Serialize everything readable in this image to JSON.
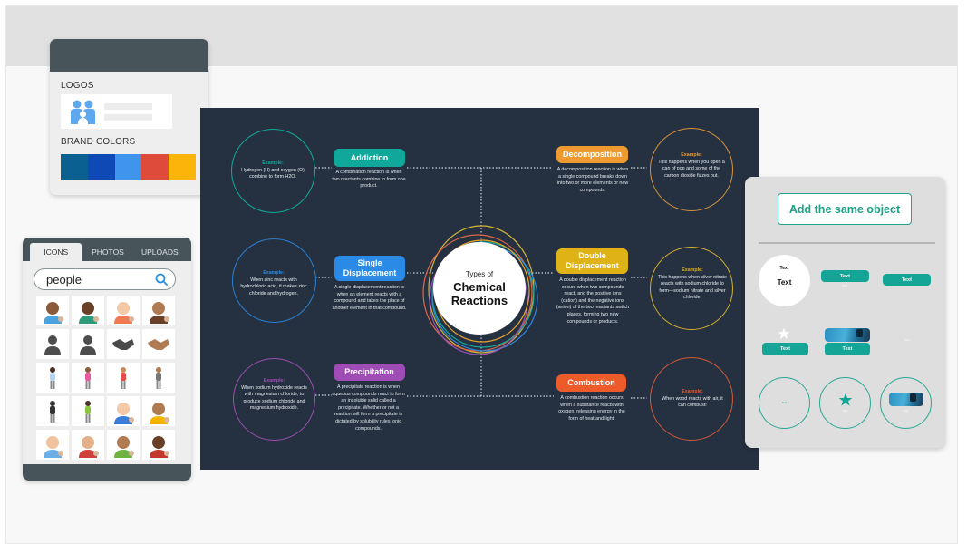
{
  "brand_panel": {
    "logos_label": "LOGOS",
    "logo_icon": "people-logo-icon",
    "brand_colors_label": "BRAND COLORS",
    "colors": [
      "#0a6191",
      "#0e49b5",
      "#3f95ec",
      "#df4b3a",
      "#fbb40a"
    ]
  },
  "icons_panel": {
    "tabs": [
      {
        "label": "ICONS",
        "active": true
      },
      {
        "label": "PHOTOS",
        "active": false
      },
      {
        "label": "UPLOADS",
        "active": false
      }
    ],
    "search_value": "people",
    "search_icon": "search-icon",
    "results": [
      "man-avatar-icon",
      "family-icon",
      "red-hair-woman-icon",
      "boy-face-icon",
      "person-silhouette-icon",
      "person-silhouette-icon",
      "handshake-icon",
      "handshake-skin-icon",
      "woman-standing-icon",
      "girl-waving-icon",
      "boy-waving-icon",
      "man-turban-icon",
      "woman-dress-icon",
      "wheelchair-user-icon",
      "pink-hair-woman-icon",
      "long-hair-woman-icon",
      "man-glasses-icon",
      "girl-ponytail-icon",
      "old-man-beard-icon",
      "bearded-man-icon"
    ]
  },
  "infographic": {
    "center": {
      "small": "Types of",
      "big_line1": "Chemical",
      "big_line2": "Reactions"
    },
    "reactions": [
      {
        "name": "Addiction",
        "color": "#0fa89a",
        "description": "A combination reaction is when two reactants combine to form one product.",
        "example_label": "Example:",
        "example": "Hydrogen (H) and oxygen (O) combine to form H2O."
      },
      {
        "name": "Single Displacement",
        "color": "#2a8ae6",
        "description": "A single-displacement reaction is when an element reacts with a compound and takes the place of another element in that compound.",
        "example_label": "Example:",
        "example": "When zinc reacts with hydrochloric acid, it makes zinc chloride and hydrogen."
      },
      {
        "name": "Precipitation",
        "color": "#a04cb6",
        "description": "A precipitate reaction is when aqueous compounds react to form an insoluble solid called a precipitate. Whether or not a reaction will form a precipitate is dictated by solubility rules ionic compounds.",
        "example_label": "Example:",
        "example": "When sodium hydroxide reacts with magnesium chloride, to produce sodium chloride and magnesium hydroxide."
      },
      {
        "name": "Decomposition",
        "color": "#ee9a2e",
        "description": "A decomposition reaction is when a single compound breaks down into two or more elements or new compounds.",
        "example_label": "Example:",
        "example": "This happens when you open a can of pop and some of the carbon dioxide fizzes out."
      },
      {
        "name": "Double Displacement",
        "color": "#dfb215",
        "description": "A double displacement reaction occurs when two compounds react, and the positive ions (cation) and the negative ions (anion) of the two reactants switch places, forming two new compounds or products.",
        "example_label": "Example:",
        "example": "This happens when silver nitrate reacts with sodium chloride to form—sodium nitrate and silver chloride."
      },
      {
        "name": "Combustion",
        "color": "#ee5b2b",
        "description": "A combustion reaction occurs when a substance reacts with oxygen, releasing energy in the form of heat and light.",
        "example_label": "Example:",
        "example": "When wood reacts with air, it can combust!"
      }
    ]
  },
  "object_panel": {
    "add_button": "Add the same object",
    "accent": "#15a596",
    "samples": {
      "circle_small_text": "Text",
      "circle_big_text": "Text",
      "pill1": "Text",
      "pill1_sub": "Text",
      "pill2": "Text",
      "star_pill": "Text",
      "photo_pill": "Text",
      "plain_tiny": "Text",
      "ring1_text": "Text",
      "ring2_text": "Text",
      "ring3_text": "Text"
    }
  }
}
